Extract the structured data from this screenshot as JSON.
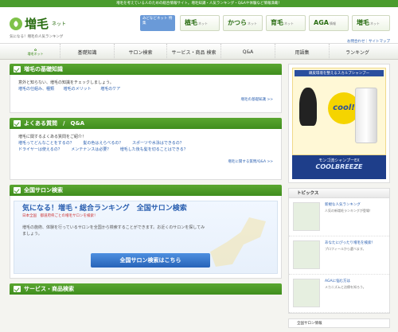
{
  "topbar_text": "増毛を考えている人のための総合情報サイト。増毛知識・人気ランキング・Q&Aや体験など情報満載！",
  "header": {
    "logo_text": "増毛",
    "logo_sub": "ネット",
    "tagline": "気になる！増毛の人気ランキング",
    "feature_button": "みどなどネット 特集",
    "categories": [
      {
        "label": "植毛",
        "sub": "ネット"
      },
      {
        "label": "かつら",
        "sub": "ネット"
      },
      {
        "label": "育毛",
        "sub": "ネット"
      },
      {
        "label": "AGA",
        "sub": "情報"
      },
      {
        "label": "増毛",
        "sub": "ネット"
      }
    ],
    "links": "お問合わせ｜サイトマップ"
  },
  "nav": {
    "home_label": "増毛ネット",
    "items": [
      "基礎知識",
      "サロン検索",
      "サービス・商品 検索",
      "Q&A",
      "用語集",
      "ランキング"
    ]
  },
  "sections": {
    "basics": {
      "title": "増毛の基礎知識",
      "intro": "意外と知らない、増毛の知識をチェックしましょう。",
      "links": [
        "増毛の仕組み、種類",
        "増毛のメリット",
        "増毛のケア"
      ],
      "more": "増毛の基礎知識 >>"
    },
    "faq": {
      "title": "よくある質問　/　Q&A",
      "intro": "増毛に関するよくある質問をご紹介！",
      "links": [
        "増毛ってどんなことをするの？",
        "髪の色はえらべるの？",
        "スポーツや水泳はできるの？",
        "ドライヤーは使えるの？",
        "メンテナンスは必要？",
        "増毛した後も髪を切ることはできる？"
      ],
      "more": "増毛に関する質問/Q&A >>"
    },
    "salon": {
      "title": "全国サロン検索",
      "banner_title": "気になる！増毛・総合ランキング　全国サロン検索",
      "banner_sub": "日本全国　都道府県ごとの増毛サロンを検索！",
      "desc": "増毛の施術、体験を行っているサロンを全国から検索することができます。お近くのサロンを探してみましょう。",
      "button": "全国サロン検索はこちら"
    },
    "services": {
      "title": "サービス・商品検索"
    }
  },
  "sidebar": {
    "ad": {
      "top_title": "頭皮環境を整えるスカルプシャンプー",
      "badge": "cool!",
      "bottom_line": "モンゴ流シャンプーEX",
      "bottom_brand": "COOLBREEZE"
    },
    "topics_title": "トピックス",
    "topics": [
      {
        "title": "新規な人気ランキング",
        "text": "人気の新増毛ランキングが登場！"
      },
      {
        "title": "あなたにぴったり増毛を検索！",
        "text": "プロフィールから選べます。"
      },
      {
        "title": "AGAに悩む方は",
        "text": "メカニズムと治療を知ろう。"
      }
    ],
    "bottom_box": "全国サロン情報"
  }
}
